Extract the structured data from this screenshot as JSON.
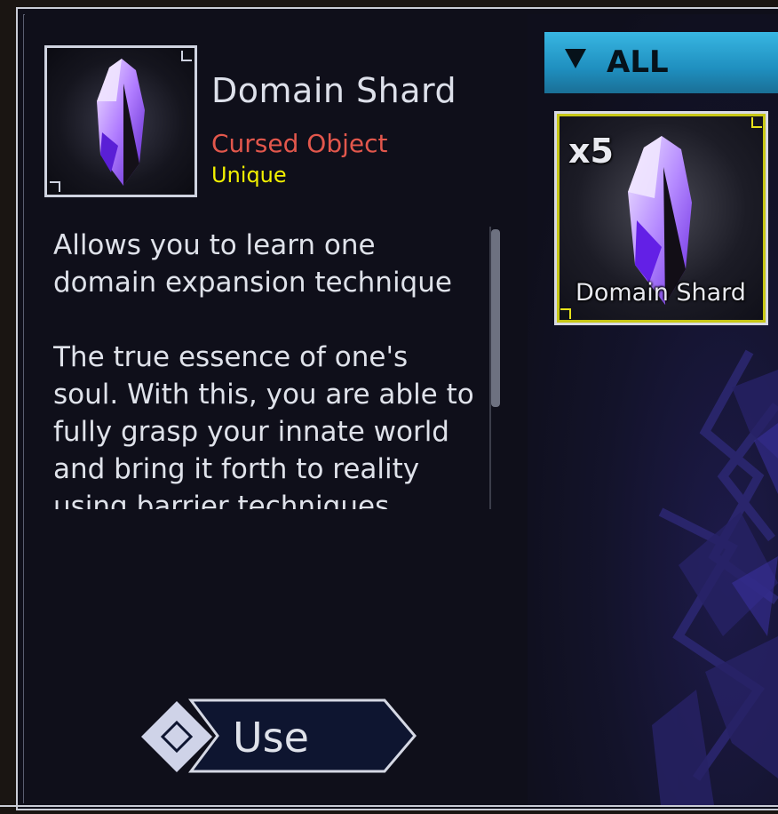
{
  "item": {
    "name": "Domain Shard",
    "category": "Cursed Object",
    "rarity": "Unique",
    "description": "Allows you to learn one\ndomain expansion technique\n\nThe true essence of one's\nsoul. With this, you are able to\nfully grasp your innate world\nand bring it forth to reality\nusing barrier techniques."
  },
  "actions": {
    "use_label": "Use"
  },
  "filter": {
    "label": "ALL"
  },
  "inventory": {
    "slots": [
      {
        "count": "x5",
        "name": "Domain Shard"
      }
    ]
  },
  "colors": {
    "category": "#e2574c",
    "rarity": "#f2f000",
    "filter_bg": "#2ba3d3",
    "slot_highlight": "#e7e21a",
    "crystal": "#8a3cff"
  },
  "icons": {
    "item_icon": "purple-crystal-icon",
    "filter_icon": "triangle-down-icon",
    "use_icon": "diamond-icon"
  }
}
